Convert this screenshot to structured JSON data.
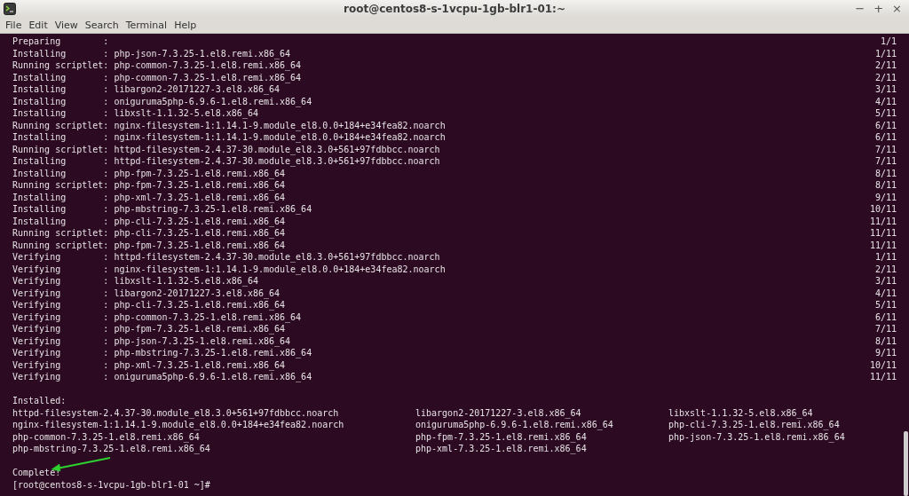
{
  "window": {
    "title": "root@centos8-s-1vcpu-1gb-blr1-01:~",
    "controls": [
      "−",
      "+",
      "×"
    ]
  },
  "menu": [
    "File",
    "Edit",
    "View",
    "Search",
    "Terminal",
    "Help"
  ],
  "transaction": [
    {
      "text": "Preparing        :",
      "progress": "1/1"
    },
    {
      "text": "Installing       : php-json-7.3.25-1.el8.remi.x86_64",
      "progress": "1/11"
    },
    {
      "text": "Running scriptlet: php-common-7.3.25-1.el8.remi.x86_64",
      "progress": "2/11"
    },
    {
      "text": "Installing       : php-common-7.3.25-1.el8.remi.x86_64",
      "progress": "2/11"
    },
    {
      "text": "Installing       : libargon2-20171227-3.el8.x86_64",
      "progress": "3/11"
    },
    {
      "text": "Installing       : oniguruma5php-6.9.6-1.el8.remi.x86_64",
      "progress": "4/11"
    },
    {
      "text": "Installing       : libxslt-1.1.32-5.el8.x86_64",
      "progress": "5/11"
    },
    {
      "text": "Running scriptlet: nginx-filesystem-1:1.14.1-9.module_el8.0.0+184+e34fea82.noarch",
      "progress": "6/11"
    },
    {
      "text": "Installing       : nginx-filesystem-1:1.14.1-9.module_el8.0.0+184+e34fea82.noarch",
      "progress": "6/11"
    },
    {
      "text": "Running scriptlet: httpd-filesystem-2.4.37-30.module_el8.3.0+561+97fdbbcc.noarch",
      "progress": "7/11"
    },
    {
      "text": "Installing       : httpd-filesystem-2.4.37-30.module_el8.3.0+561+97fdbbcc.noarch",
      "progress": "7/11"
    },
    {
      "text": "Installing       : php-fpm-7.3.25-1.el8.remi.x86_64",
      "progress": "8/11"
    },
    {
      "text": "Running scriptlet: php-fpm-7.3.25-1.el8.remi.x86_64",
      "progress": "8/11"
    },
    {
      "text": "Installing       : php-xml-7.3.25-1.el8.remi.x86_64",
      "progress": "9/11"
    },
    {
      "text": "Installing       : php-mbstring-7.3.25-1.el8.remi.x86_64",
      "progress": "10/11"
    },
    {
      "text": "Installing       : php-cli-7.3.25-1.el8.remi.x86_64",
      "progress": "11/11"
    },
    {
      "text": "Running scriptlet: php-cli-7.3.25-1.el8.remi.x86_64",
      "progress": "11/11"
    },
    {
      "text": "Running scriptlet: php-fpm-7.3.25-1.el8.remi.x86_64",
      "progress": "11/11"
    },
    {
      "text": "Verifying        : httpd-filesystem-2.4.37-30.module_el8.3.0+561+97fdbbcc.noarch",
      "progress": "1/11"
    },
    {
      "text": "Verifying        : nginx-filesystem-1:1.14.1-9.module_el8.0.0+184+e34fea82.noarch",
      "progress": "2/11"
    },
    {
      "text": "Verifying        : libxslt-1.1.32-5.el8.x86_64",
      "progress": "3/11"
    },
    {
      "text": "Verifying        : libargon2-20171227-3.el8.x86_64",
      "progress": "4/11"
    },
    {
      "text": "Verifying        : php-cli-7.3.25-1.el8.remi.x86_64",
      "progress": "5/11"
    },
    {
      "text": "Verifying        : php-common-7.3.25-1.el8.remi.x86_64",
      "progress": "6/11"
    },
    {
      "text": "Verifying        : php-fpm-7.3.25-1.el8.remi.x86_64",
      "progress": "7/11"
    },
    {
      "text": "Verifying        : php-json-7.3.25-1.el8.remi.x86_64",
      "progress": "8/11"
    },
    {
      "text": "Verifying        : php-mbstring-7.3.25-1.el8.remi.x86_64",
      "progress": "9/11"
    },
    {
      "text": "Verifying        : php-xml-7.3.25-1.el8.remi.x86_64",
      "progress": "10/11"
    },
    {
      "text": "Verifying        : oniguruma5php-6.9.6-1.el8.remi.x86_64",
      "progress": "11/11"
    }
  ],
  "installed": {
    "heading": "Installed:",
    "packages": [
      "httpd-filesystem-2.4.37-30.module_el8.3.0+561+97fdbbcc.noarch",
      "libargon2-20171227-3.el8.x86_64",
      "libxslt-1.1.32-5.el8.x86_64",
      "nginx-filesystem-1:1.14.1-9.module_el8.0.0+184+e34fea82.noarch",
      "oniguruma5php-6.9.6-1.el8.remi.x86_64",
      "php-cli-7.3.25-1.el8.remi.x86_64",
      "php-common-7.3.25-1.el8.remi.x86_64",
      "php-fpm-7.3.25-1.el8.remi.x86_64",
      "php-json-7.3.25-1.el8.remi.x86_64",
      "php-mbstring-7.3.25-1.el8.remi.x86_64",
      "php-xml-7.3.25-1.el8.remi.x86_64"
    ]
  },
  "status": "Complete!",
  "prompt": "[root@centos8-s-1vcpu-1gb-blr1-01 ~]#"
}
